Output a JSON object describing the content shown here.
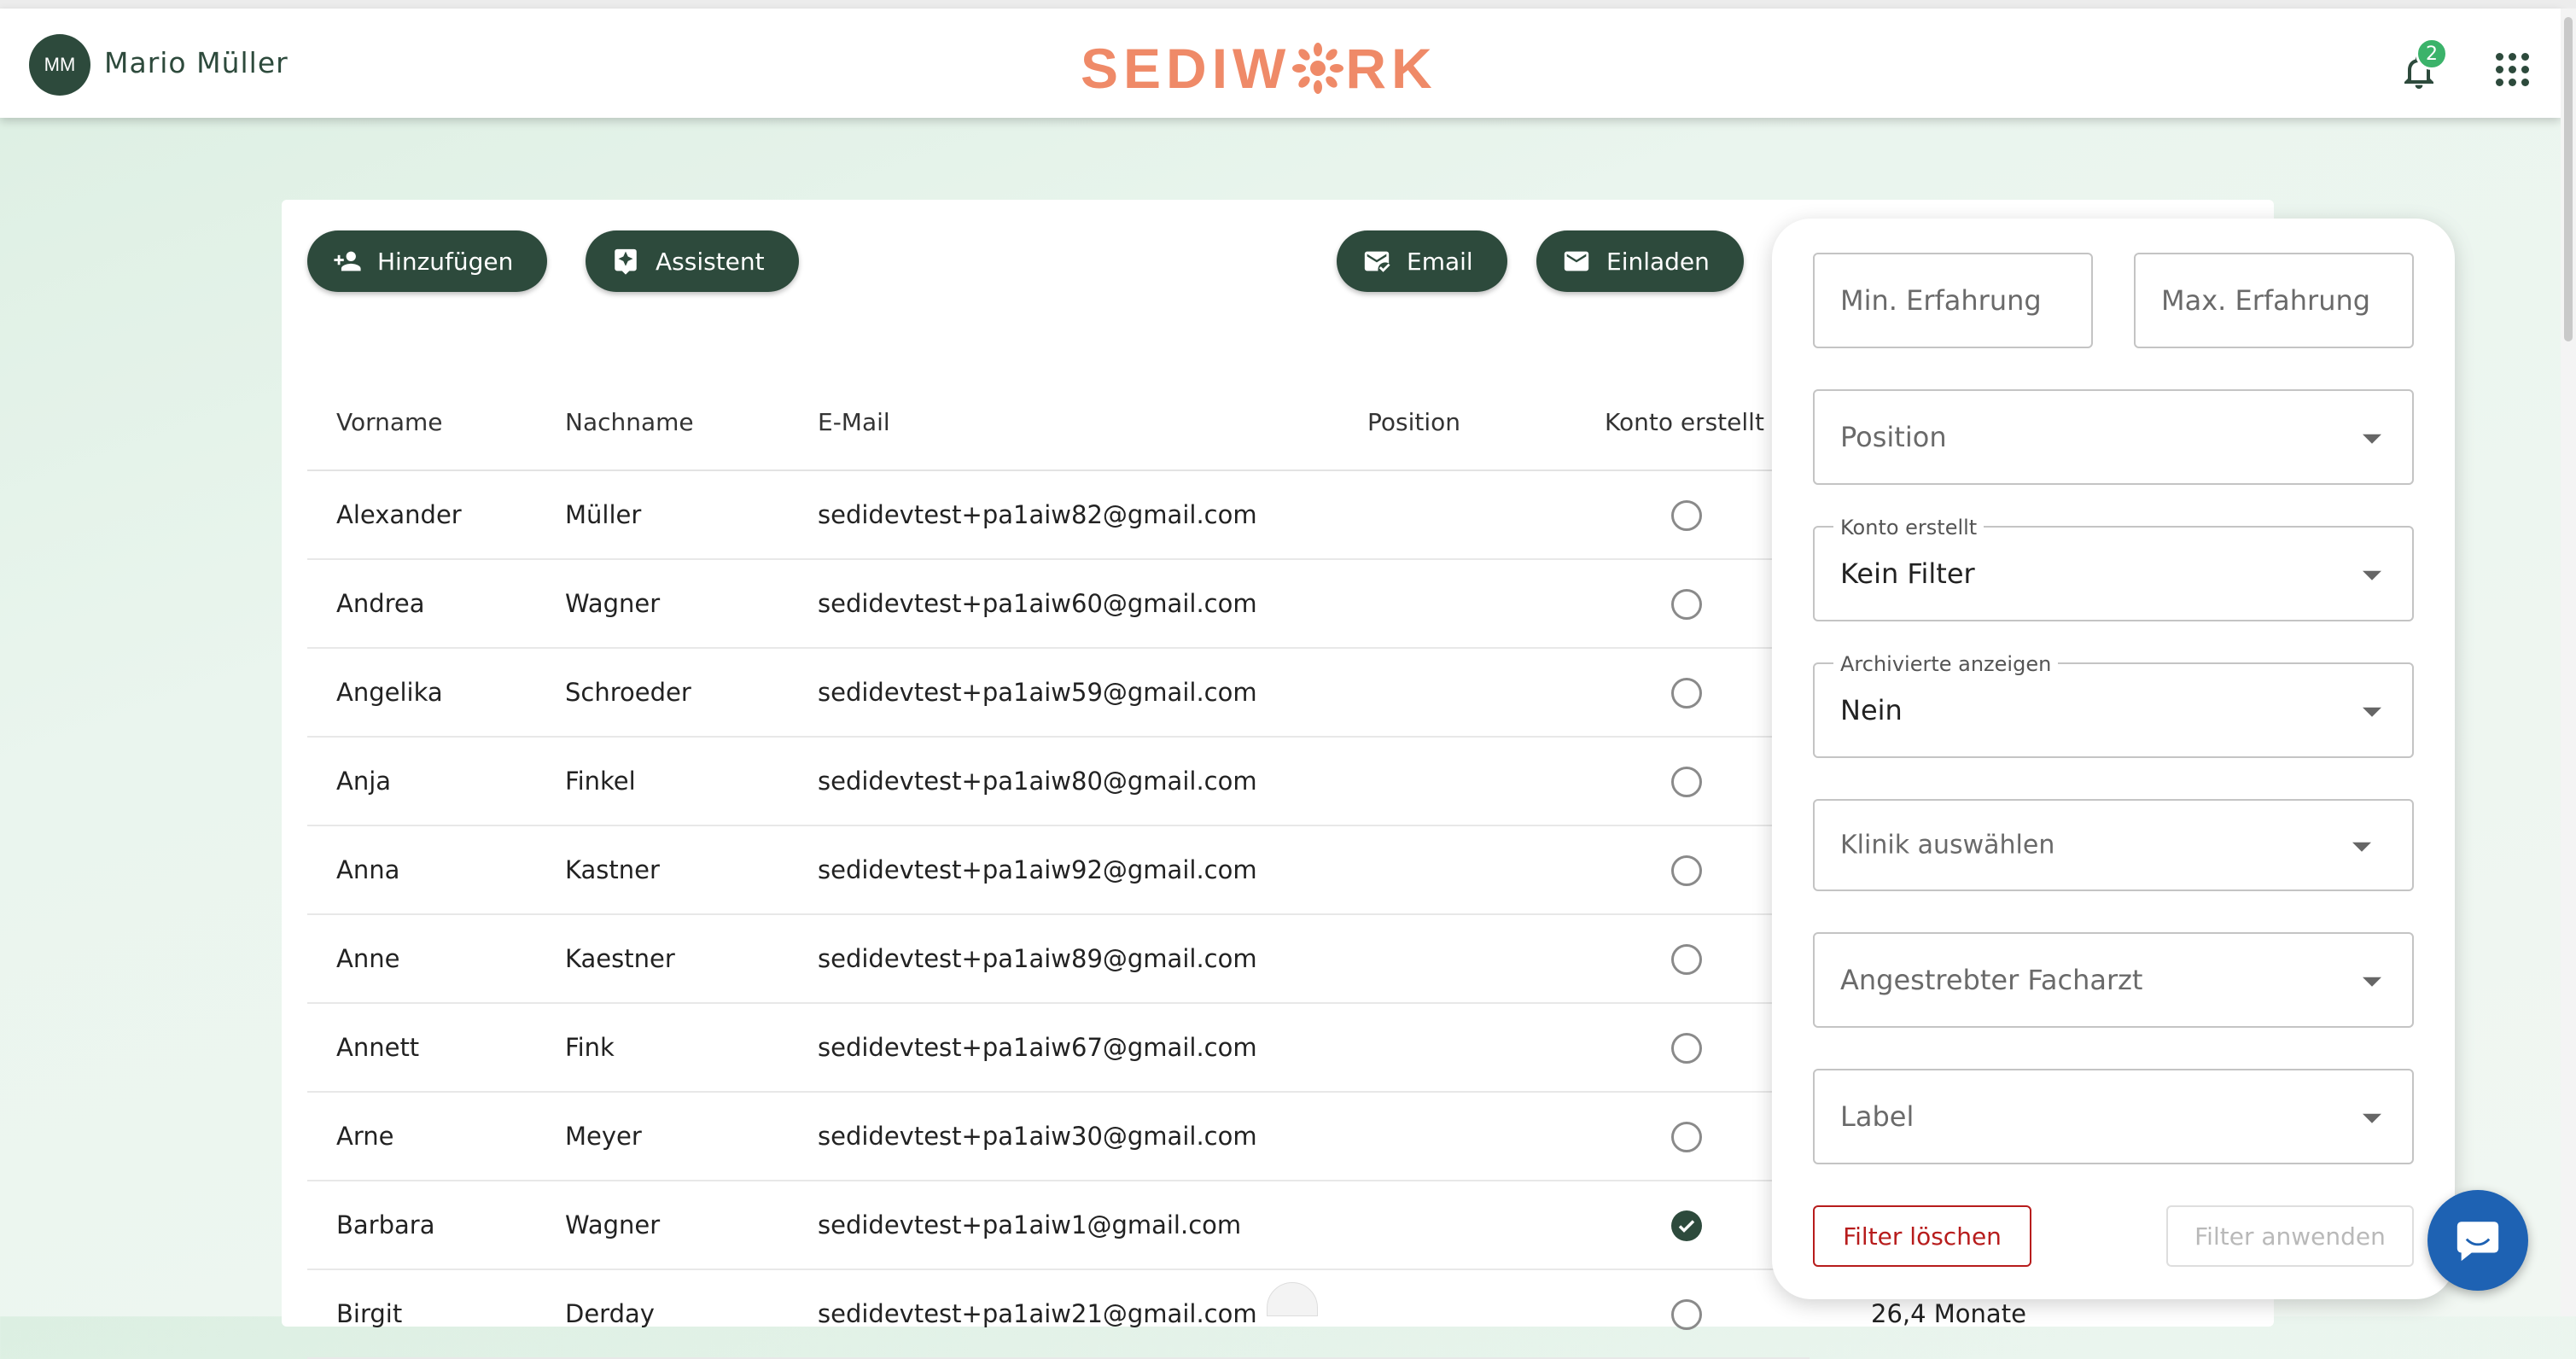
{
  "header": {
    "avatar_initials": "MM",
    "user_name": "Mario Müller",
    "logo": "SEDIWORK",
    "notification_count": "2"
  },
  "toolbar": {
    "add_label": "Hinzufügen",
    "assistant_label": "Assistent",
    "email_label": "Email",
    "invite_label": "Einladen"
  },
  "table": {
    "columns": [
      "Vorname",
      "Nachname",
      "E-Mail",
      "Position",
      "Konto erstellt"
    ],
    "rows": [
      {
        "first": "Alexander",
        "last": "Müller",
        "email": "sedidevtest+pa1aiw82@gmail.com",
        "created": false
      },
      {
        "first": "Andrea",
        "last": "Wagner",
        "email": "sedidevtest+pa1aiw60@gmail.com",
        "created": false
      },
      {
        "first": "Angelika",
        "last": "Schroeder",
        "email": "sedidevtest+pa1aiw59@gmail.com",
        "created": false
      },
      {
        "first": "Anja",
        "last": "Finkel",
        "email": "sedidevtest+pa1aiw80@gmail.com",
        "created": false
      },
      {
        "first": "Anna",
        "last": "Kastner",
        "email": "sedidevtest+pa1aiw92@gmail.com",
        "created": false
      },
      {
        "first": "Anne",
        "last": "Kaestner",
        "email": "sedidevtest+pa1aiw89@gmail.com",
        "created": false
      },
      {
        "first": "Annett",
        "last": "Fink",
        "email": "sedidevtest+pa1aiw67@gmail.com",
        "created": false
      },
      {
        "first": "Arne",
        "last": "Meyer",
        "email": "sedidevtest+pa1aiw30@gmail.com",
        "created": false
      },
      {
        "first": "Barbara",
        "last": "Wagner",
        "email": "sedidevtest+pa1aiw1@gmail.com",
        "created": true
      },
      {
        "first": "Birgit",
        "last": "Derday",
        "email": "sedidevtest+pa1aiw21@gmail.com",
        "created": false
      }
    ],
    "partial_experience": "26,4 Monate"
  },
  "filter": {
    "min_exp_placeholder": "Min. Erfahrung",
    "max_exp_placeholder": "Max. Erfahrung",
    "position_placeholder": "Position",
    "account_label": "Konto erstellt",
    "account_value": "Kein Filter",
    "archived_label": "Archivierte anzeigen",
    "archived_value": "Nein",
    "clinic_placeholder": "Klinik auswählen",
    "specialist_placeholder": "Angestrebter Facharzt",
    "label_placeholder": "Label",
    "clear_label": "Filter löschen",
    "apply_label": "Filter anwenden"
  },
  "colors": {
    "primary": "#2d4a3c",
    "logo": "#ef8a68",
    "danger": "#b71c1c",
    "badge": "#3bb36a",
    "chat": "#1e62b3"
  }
}
